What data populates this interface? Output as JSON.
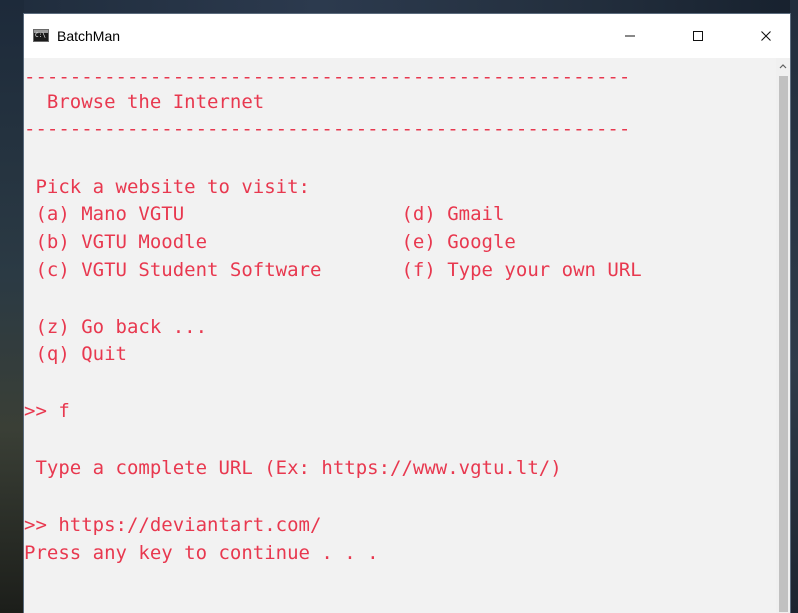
{
  "window": {
    "title": "BatchMan",
    "icon": "console-icon",
    "controls": [
      "minimize-icon",
      "maximize-icon",
      "close-icon"
    ]
  },
  "colors": {
    "text": "#e8384f",
    "console_background": "#f2f2f2",
    "titlebar": "#ffffff"
  },
  "console": {
    "lines": [
      "-----------------------------------------------------",
      "  Browse the Internet",
      "-----------------------------------------------------",
      " Pick a website to visit:",
      " (a) Mano VGTU                   (d) Gmail",
      " (b) VGTU Moodle                 (e) Google",
      " (c) VGTU Student Software       (f) Type your own URL",
      " (z) Go back ...",
      " (q) Quit",
      ">> f",
      " Type a complete URL (Ex: https://www.vgtu.lt/)",
      ">> https://deviantart.com/",
      "Press any key to continue . . ."
    ]
  }
}
